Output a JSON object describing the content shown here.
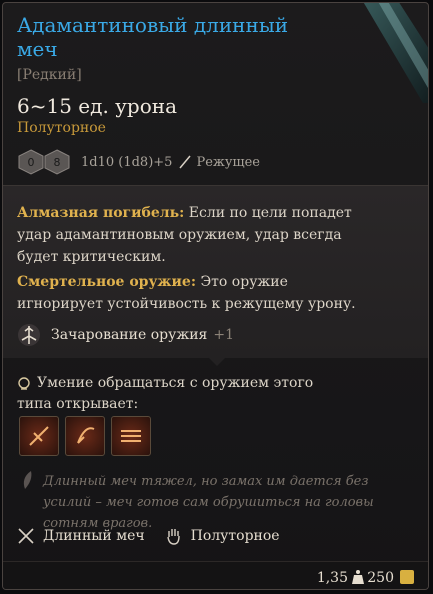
{
  "item": {
    "name": "Адамантиновый длинный меч",
    "rarity": "[Редкий]",
    "damage": "6~15 ед. урона",
    "property": "Полуторное",
    "damage_formula": "1d10 (1d8)+5",
    "damage_type": "Режущее",
    "dice": {
      "left": "0",
      "right": "8"
    }
  },
  "passives": [
    {
      "title": "Алмазная погибель:",
      "text": "Если по цели попадет удар адамантиновым оружием, удар всегда будет критическим."
    },
    {
      "title": "Смертельное оружие:",
      "text": "Это оружие игнорирует устойчивость к режущему урону."
    }
  ],
  "enchantment": {
    "label": "Зачарование оружия",
    "value": "+1"
  },
  "proficiency": {
    "text": "Умение обращаться с оружием этого типа открывает:"
  },
  "actions": [
    "slash-action-icon",
    "lacerate-action-icon",
    "pommel-strike-action-icon"
  ],
  "flavor": "Длинный меч тяжел, но замах им дается без усилий – меч готов сам обрушиться на головы сотням врагов.",
  "tags": [
    {
      "label": "Длинный меч",
      "icon": "crossed-swords-icon"
    },
    {
      "label": "Полуторное",
      "icon": "hand-icon"
    }
  ],
  "footer": {
    "weight": "1,35",
    "price": "250"
  },
  "colors": {
    "title": "#3aa9e6",
    "accent": "#e0b24e",
    "property": "#c89a3a"
  }
}
